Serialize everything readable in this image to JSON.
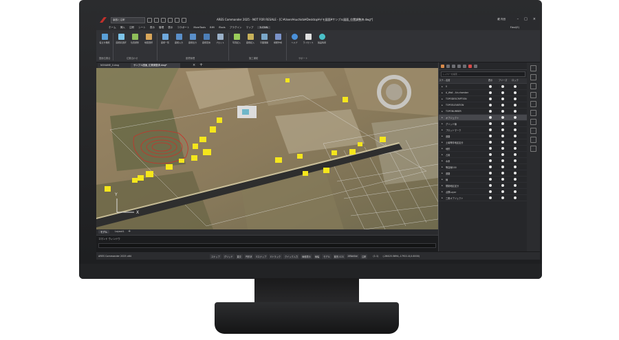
{
  "app": {
    "title": "ARES Commander 2025 - NOT FOR RESALE - [C:¥Users¥suchida¥Desktop¥デモ図面¥サンプル図面_位置調整済.dwg*]",
    "workspace": "製図と注釈",
    "user": "龍 内田",
    "flexi_label": "Flexi(E)"
  },
  "menu": [
    "ホーム",
    "挿入",
    "注釈",
    "シート",
    "表示",
    "管理",
    "表示",
    "コラボート",
    "MoreTools",
    "BIM",
    "iTools",
    "プラグイン",
    "マップ",
    "3-CIVIL"
  ],
  "ribbon": {
    "buttons": [
      "役立ち機能",
      "座標系選択",
      "位置調整",
      "地図選択",
      "座標一覧",
      "座標入力",
      "座標出力",
      "座標変換",
      "プロット",
      "写真記入",
      "座標記入",
      "平面展開",
      "横断作成",
      "ヘルプ",
      "ライセンス",
      "製品情報"
    ],
    "groups": [
      "図面位置合",
      "位置合わせ",
      "座標管理",
      "施工補助",
      "サポート"
    ]
  },
  "doc_tabs": [
    "NONAME_0.dwg",
    "サンプル図面_位置調整済.dwg*"
  ],
  "layout_tabs": [
    "モデル",
    "Layout1"
  ],
  "command_window": {
    "label": "コマンド ウィンドウ"
  },
  "status": {
    "app_name": "ARES Commander 2025 x64",
    "buttons": [
      "スナップ",
      "グリッド",
      "直交",
      "円形状",
      "Eスナップ",
      "Eトラック",
      "クイック入力",
      "線種表示",
      "線幅",
      "モデル",
      "動的 CCS",
      "AMonitor",
      "注釈"
    ],
    "scale": "(1:1)",
    "coords": "(-26425.5694,-17921.8,0.0000)"
  },
  "layer_panel": {
    "search_placeholder": "レイヤーを検索 ...",
    "headers": {
      "status": "ステ...",
      "name": "名前",
      "on": "表示",
      "freeze": "フリーズ",
      "lock": "ロック"
    },
    "rows": [
      {
        "name": "0"
      },
      {
        "name": "A_Wall - Air-chamber"
      },
      {
        "name": "TOPODESCRIPTION"
      },
      {
        "name": "TOPOELEVATION"
      },
      {
        "name": "TOPONUMBER"
      },
      {
        "name": "オブジェクト",
        "selected": true
      },
      {
        "name": "グリッド線"
      },
      {
        "name": "プロットマーク"
      },
      {
        "name": "道路"
      },
      {
        "name": "土壌等非地区区分"
      },
      {
        "name": "地形"
      },
      {
        "name": "占用"
      },
      {
        "name": "水系"
      },
      {
        "name": "等高線100"
      },
      {
        "name": "道路"
      },
      {
        "name": "線"
      },
      {
        "name": "規制地区区分"
      },
      {
        "name": "点群Layer"
      },
      {
        "name": "三角オブジェクト"
      }
    ]
  },
  "viewport": {
    "axis_x": "X",
    "axis_y": "Y"
  },
  "colors": {
    "accent": "#c0302b",
    "buildings": "#f5e61c",
    "contour": "#c8312a",
    "road": "#2e2e2e"
  }
}
